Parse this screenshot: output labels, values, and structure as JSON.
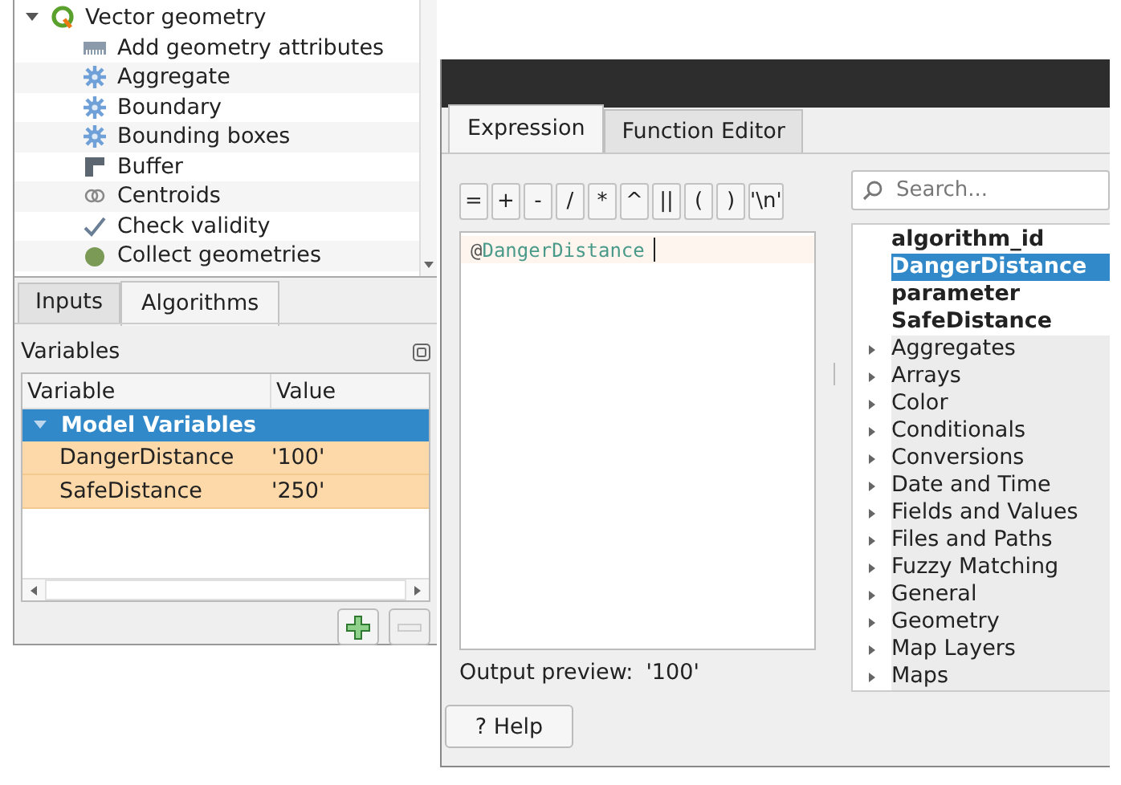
{
  "tree": {
    "items": [
      {
        "label": "Vector geometry",
        "expanded": true,
        "children": [
          {
            "label": "Add geometry attributes",
            "kind": "ruler"
          },
          {
            "label": "Aggregate",
            "kind": "gear"
          },
          {
            "label": "Boundary",
            "kind": "gear"
          },
          {
            "label": "Bounding boxes",
            "kind": "gear"
          },
          {
            "label": "Buffer",
            "kind": "buffer"
          },
          {
            "label": "Centroids",
            "kind": "rings"
          },
          {
            "label": "Check validity",
            "kind": "check"
          },
          {
            "label": "Collect geometries",
            "kind": "blob"
          }
        ]
      }
    ]
  },
  "left_tabs": [
    {
      "label": "Inputs",
      "selected": false
    },
    {
      "label": "Algorithms",
      "selected": true
    }
  ],
  "variables": {
    "title": "Variables",
    "columns": [
      "Variable",
      "Value"
    ],
    "group": {
      "label": "Model Variables",
      "expanded": true,
      "selected": true
    },
    "rows": [
      {
        "name": "DangerDistance",
        "value": "'100'"
      },
      {
        "name": "SafeDistance",
        "value": "'250'"
      }
    ]
  },
  "dialog": {
    "tabs": [
      {
        "label": "Expression",
        "selected": true
      },
      {
        "label": "Function Editor",
        "selected": false
      }
    ],
    "operators": [
      "=",
      "+",
      "-",
      "/",
      "*",
      "^",
      "||",
      "(",
      ")",
      "'\\n'"
    ],
    "expression": {
      "prefix": "@",
      "name": "DangerDistance"
    },
    "output_preview": {
      "label": "Output preview:",
      "value": "'100'"
    },
    "search": {
      "placeholder": "Search..."
    },
    "functions": [
      {
        "label": "algorithm_id",
        "kind": "variable",
        "selected": false
      },
      {
        "label": "DangerDistance",
        "kind": "variable",
        "selected": true
      },
      {
        "label": "parameter",
        "kind": "variable",
        "selected": false
      },
      {
        "label": "SafeDistance",
        "kind": "variable",
        "selected": false
      },
      {
        "label": "Aggregates",
        "kind": "group",
        "selected": false
      },
      {
        "label": "Arrays",
        "kind": "group",
        "selected": false
      },
      {
        "label": "Color",
        "kind": "group",
        "selected": false
      },
      {
        "label": "Conditionals",
        "kind": "group",
        "selected": false
      },
      {
        "label": "Conversions",
        "kind": "group",
        "selected": false
      },
      {
        "label": "Date and Time",
        "kind": "group",
        "selected": false
      },
      {
        "label": "Fields and Values",
        "kind": "group",
        "selected": false
      },
      {
        "label": "Files and Paths",
        "kind": "group",
        "selected": false
      },
      {
        "label": "Fuzzy Matching",
        "kind": "group",
        "selected": false
      },
      {
        "label": "General",
        "kind": "group",
        "selected": false
      },
      {
        "label": "Geometry",
        "kind": "group",
        "selected": false
      },
      {
        "label": "Map Layers",
        "kind": "group",
        "selected": false
      },
      {
        "label": "Maps",
        "kind": "group",
        "selected": false
      }
    ],
    "help_button": "? Help"
  }
}
